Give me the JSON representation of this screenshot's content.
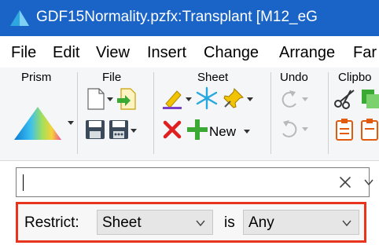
{
  "window": {
    "title": "GDF15Normality.pzfx:Transplant [M12_eG"
  },
  "menubar": {
    "items": [
      "File",
      "Edit",
      "View",
      "Insert",
      "Change",
      "Arrange",
      "Far"
    ]
  },
  "ribbon": {
    "groups": {
      "prism": "Prism",
      "file": "File",
      "sheet": "Sheet",
      "undo": "Undo",
      "clipboard": "Clipbo"
    },
    "new_label": "New"
  },
  "search": {
    "value": "",
    "placeholder": ""
  },
  "restrict": {
    "label": "Restrict:",
    "scope_value": "Sheet",
    "is_label": "is",
    "filter_value": "Any"
  },
  "colors": {
    "titlebar": "#1a64c8",
    "highlight_border": "#e8341c",
    "delete_red": "#e02020",
    "add_green": "#3aaa35"
  }
}
